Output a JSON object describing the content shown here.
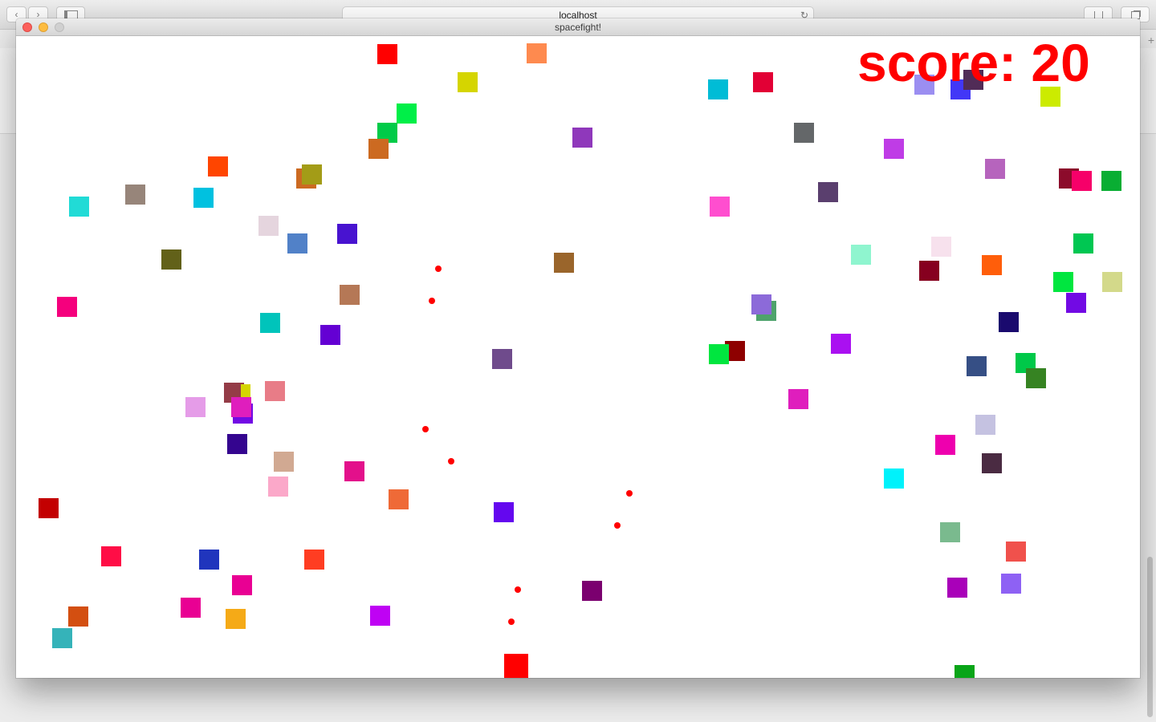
{
  "browser": {
    "url": "localhost",
    "reload_icon": "↻",
    "back_icon": "‹",
    "forward_icon": "›",
    "plus_icon": "+"
  },
  "window": {
    "title": "spacefight!"
  },
  "game": {
    "score_text": "score: 20",
    "score_color": "#ff0000",
    "player_color": "#ff0000",
    "bullet_color": "#ff0000",
    "enemy_colors": [
      "#ff0000",
      "#fe8a4f",
      "#d5d500",
      "#00ef48",
      "#00cb48",
      "#cc6a21",
      "#8f38bb",
      "#00bcd6",
      "#e20035",
      "#9b8ef1",
      "#4237f7",
      "#512c57",
      "#cceb00",
      "#646769",
      "#bf3ce6",
      "#b664bd",
      "#8c0b2b",
      "#f60069",
      "#09ae33",
      "#ff4500",
      "#a39c17",
      "#97857a",
      "#21dbd6",
      "#00c1e0",
      "#ff4ecf",
      "#5a3f6e",
      "#e5d5de",
      "#5181c8",
      "#4813d0",
      "#626119",
      "#9a652b",
      "#f7e1ed",
      "#86001f",
      "#ff5e0a",
      "#00c752",
      "#d3d98a",
      "#f5007d",
      "#b57856",
      "#00c4bb",
      "#6400d3",
      "#00e63f",
      "#8c6ad9",
      "#8e0000",
      "#aa10f1",
      "#1a0a6e",
      "#720ae4",
      "#364f85",
      "#00c949",
      "#368322",
      "#6f4b8c",
      "#e87c87",
      "#943c47",
      "#df1ebd",
      "#e59ce8",
      "#34058f",
      "#d1a992",
      "#fba8c9",
      "#e3108b",
      "#ef6a37",
      "#6407ef",
      "#c30001",
      "#ff0d46",
      "#2035bd",
      "#ff3d22",
      "#e90093",
      "#bf02f4",
      "#f5aa17",
      "#d34f11",
      "#35b3b9",
      "#7b006f",
      "#ee00ae",
      "#c5c2e1",
      "#4a2b42",
      "#00f2fb",
      "#7aba8e",
      "#f0514c",
      "#a900b9",
      "#8e61f4",
      "#09a518"
    ]
  }
}
